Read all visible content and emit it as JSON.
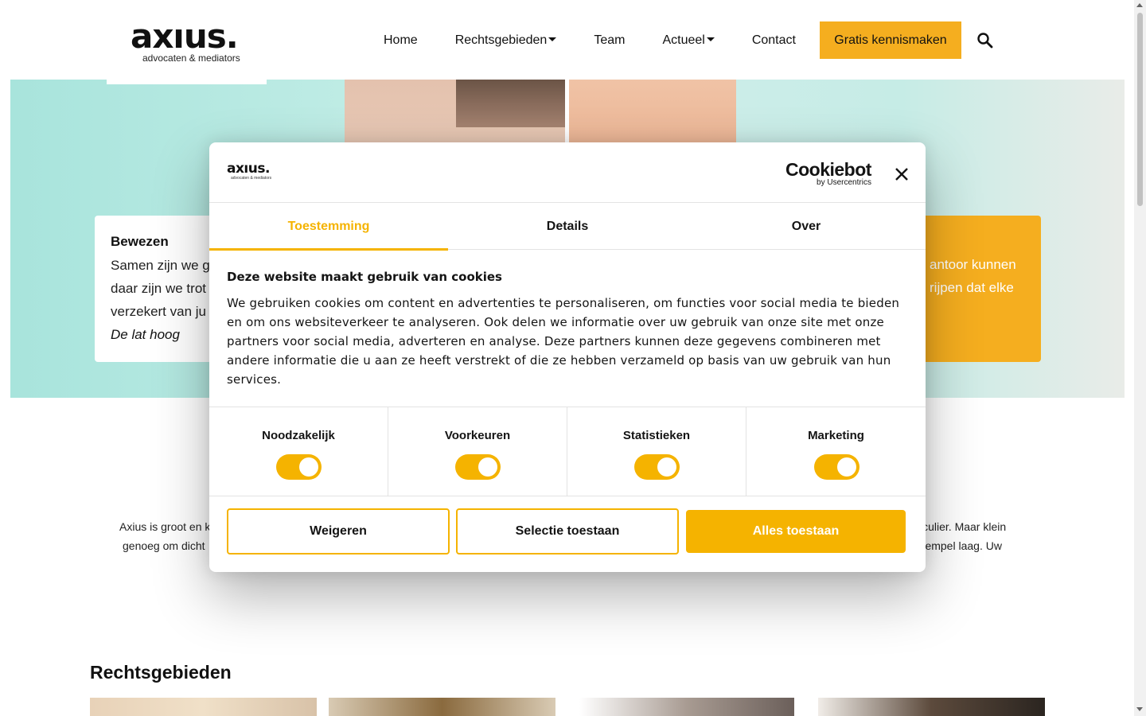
{
  "header": {
    "logo_word": "axıus.",
    "logo_sub": "advocaten & mediators",
    "nav": [
      {
        "label": "Home",
        "dropdown": false
      },
      {
        "label": "Rechtsgebieden",
        "dropdown": true
      },
      {
        "label": "Team",
        "dropdown": false
      },
      {
        "label": "Actueel",
        "dropdown": true
      },
      {
        "label": "Contact",
        "dropdown": false
      }
    ],
    "cta": "Gratis kennismaken",
    "search_icon": "search-icon"
  },
  "hero": {
    "left_card": {
      "title": "Bewezen",
      "line1": "Samen zijn we g",
      "line2": "daar zijn we trot",
      "line3": "verzekert van ju",
      "emphasis": "De lat hoog"
    },
    "right_card": {
      "line1": "antoor kunnen",
      "line2": "rijpen dat elke"
    }
  },
  "intro": {
    "left_line1": "Axius is groot en k",
    "left_line2": "genoeg om dicht",
    "right_line1": "iculier. Maar klein",
    "right_line2": "drempel laag. Uw"
  },
  "section_title": "Rechtsgebieden",
  "cookie_dialog": {
    "logo_word": "axıus.",
    "logo_sub": "advocaten & mediators",
    "brand": "Cookiebot",
    "brand_by": "by Usercentrics",
    "tabs": [
      {
        "label": "Toestemming",
        "active": true
      },
      {
        "label": "Details",
        "active": false
      },
      {
        "label": "Over",
        "active": false
      }
    ],
    "heading": "Deze website maakt gebruik van cookies",
    "body": "We gebruiken cookies om content en advertenties te personaliseren, om functies voor social media te bieden en om ons websiteverkeer te analyseren. Ook delen we informatie over uw gebruik van onze site met onze partners voor social media, adverteren en analyse. Deze partners kunnen deze gegevens combineren met andere informatie die u aan ze heeft verstrekt of die ze hebben verzameld op basis van uw gebruik van hun services.",
    "categories": [
      {
        "label": "Noodzakelijk",
        "enabled": true
      },
      {
        "label": "Voorkeuren",
        "enabled": true
      },
      {
        "label": "Statistieken",
        "enabled": true
      },
      {
        "label": "Marketing",
        "enabled": true
      }
    ],
    "buttons": {
      "deny": "Weigeren",
      "selection": "Selectie toestaan",
      "allow_all": "Alles toestaan"
    }
  },
  "colors": {
    "accent": "#f5b300",
    "nav_cta": "#f5ae1f",
    "hero_bg": "#c2ede6"
  }
}
